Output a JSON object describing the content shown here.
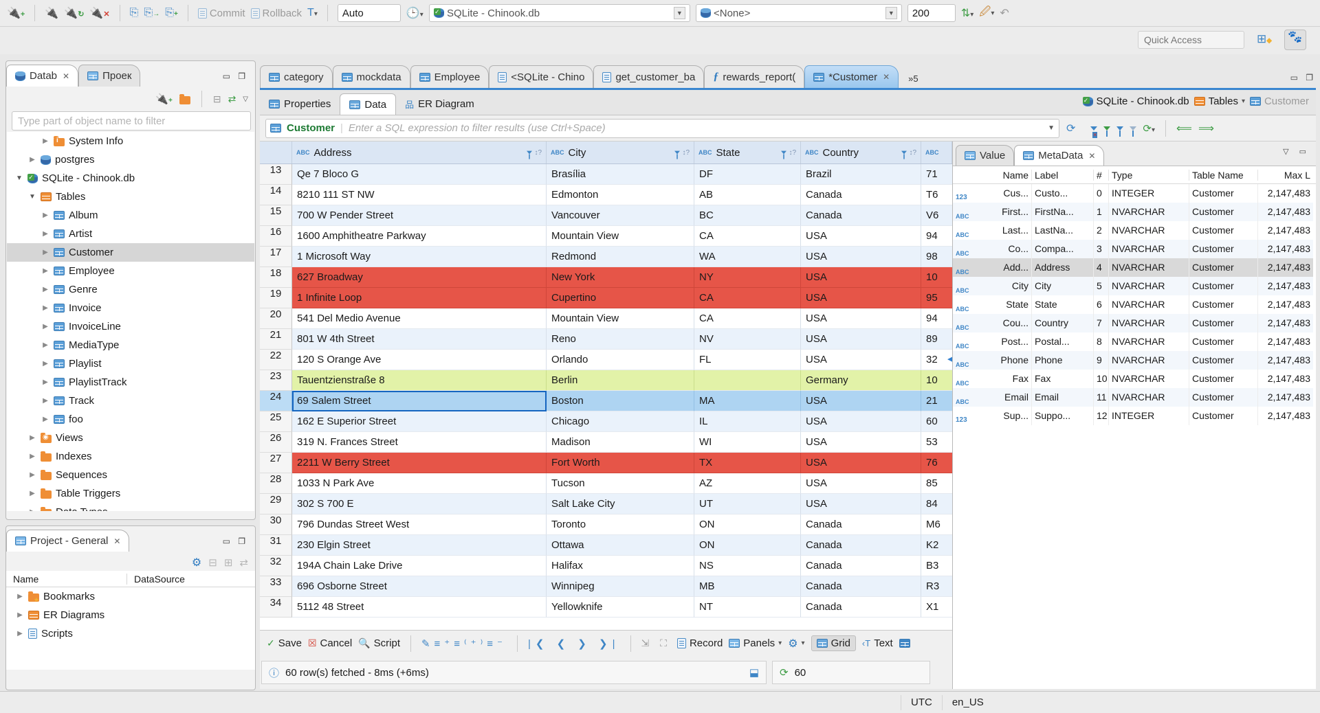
{
  "toolbar": {
    "commit_label": "Commit",
    "rollback_label": "Rollback",
    "txn_mode": "Auto",
    "connection": "SQLite - Chinook.db",
    "schema": "<None>",
    "fetch_size": "200",
    "quick_access_placeholder": "Quick Access"
  },
  "navigator": {
    "tabs": [
      {
        "label": "Datab",
        "closable": true
      },
      {
        "label": "Проек",
        "closable": false
      }
    ],
    "filter_placeholder": "Type part of object name to filter",
    "tree": [
      {
        "label": "System Info",
        "icon": "folder-info",
        "level": 2,
        "state": "collapsed",
        "selected": false
      },
      {
        "label": "postgres",
        "icon": "db",
        "level": 1,
        "state": "collapsed",
        "selected": false
      },
      {
        "label": "SQLite - Chinook.db",
        "icon": "db-check",
        "level": 0,
        "state": "expanded",
        "selected": false
      },
      {
        "label": "Tables",
        "icon": "table-folder",
        "level": 1,
        "state": "expanded",
        "selected": false
      },
      {
        "label": "Album",
        "icon": "table",
        "level": 2,
        "state": "collapsed",
        "selected": false
      },
      {
        "label": "Artist",
        "icon": "table",
        "level": 2,
        "state": "collapsed",
        "selected": false
      },
      {
        "label": "Customer",
        "icon": "table",
        "level": 2,
        "state": "collapsed",
        "selected": true
      },
      {
        "label": "Employee",
        "icon": "table",
        "level": 2,
        "state": "collapsed",
        "selected": false
      },
      {
        "label": "Genre",
        "icon": "table",
        "level": 2,
        "state": "collapsed",
        "selected": false
      },
      {
        "label": "Invoice",
        "icon": "table",
        "level": 2,
        "state": "collapsed",
        "selected": false
      },
      {
        "label": "InvoiceLine",
        "icon": "table",
        "level": 2,
        "state": "collapsed",
        "selected": false
      },
      {
        "label": "MediaType",
        "icon": "table",
        "level": 2,
        "state": "collapsed",
        "selected": false
      },
      {
        "label": "Playlist",
        "icon": "table",
        "level": 2,
        "state": "collapsed",
        "selected": false
      },
      {
        "label": "PlaylistTrack",
        "icon": "table",
        "level": 2,
        "state": "collapsed",
        "selected": false
      },
      {
        "label": "Track",
        "icon": "table",
        "level": 2,
        "state": "collapsed",
        "selected": false
      },
      {
        "label": "foo",
        "icon": "table",
        "level": 2,
        "state": "collapsed",
        "selected": false
      },
      {
        "label": "Views",
        "icon": "folder-eye",
        "level": 1,
        "state": "collapsed",
        "selected": false
      },
      {
        "label": "Indexes",
        "icon": "folder",
        "level": 1,
        "state": "collapsed",
        "selected": false
      },
      {
        "label": "Sequences",
        "icon": "folder",
        "level": 1,
        "state": "collapsed",
        "selected": false
      },
      {
        "label": "Table Triggers",
        "icon": "folder",
        "level": 1,
        "state": "collapsed",
        "selected": false
      },
      {
        "label": "Data Types",
        "icon": "folder",
        "level": 1,
        "state": "collapsed",
        "selected": false
      }
    ]
  },
  "project": {
    "title": "Project - General",
    "columns": [
      "Name",
      "DataSource"
    ],
    "items": [
      {
        "label": "Bookmarks",
        "icon": "folder-star"
      },
      {
        "label": "ER Diagrams",
        "icon": "er"
      },
      {
        "label": "Scripts",
        "icon": "scripts"
      }
    ]
  },
  "editor": {
    "tabs": [
      {
        "label": "category",
        "icon": "table",
        "active": false,
        "closable": false
      },
      {
        "label": "mockdata",
        "icon": "table",
        "active": false,
        "closable": false
      },
      {
        "label": "Employee",
        "icon": "table",
        "active": false,
        "closable": false
      },
      {
        "label": "<SQLite - Chino",
        "icon": "sql",
        "active": false,
        "closable": false
      },
      {
        "label": "get_customer_ba",
        "icon": "sql-check",
        "active": false,
        "closable": false
      },
      {
        "label": "rewards_report(",
        "icon": "fn",
        "active": false,
        "closable": false
      },
      {
        "label": "*Customer",
        "icon": "table",
        "active": true,
        "closable": true
      }
    ],
    "overflow_indicator": "»5",
    "subtabs": [
      "Properties",
      "Data",
      "ER Diagram"
    ],
    "active_subtab": "Data",
    "breadcrumb": {
      "database": "SQLite - Chinook.db",
      "container": "Tables",
      "entity": "Customer"
    }
  },
  "filter": {
    "entity": "Customer",
    "placeholder": "Enter a SQL expression to filter results (use Ctrl+Space)"
  },
  "grid": {
    "columns": [
      "Address",
      "City",
      "State",
      "Country",
      ""
    ],
    "rows": [
      {
        "n": "13",
        "address": "Qe 7 Bloco G",
        "city": "Brasília",
        "state": "DF",
        "country": "Brazil",
        "postal": "71",
        "color": "odd",
        "selected": false
      },
      {
        "n": "14",
        "address": "8210 111 ST NW",
        "city": "Edmonton",
        "state": "AB",
        "country": "Canada",
        "postal": "T6",
        "color": "even",
        "selected": false
      },
      {
        "n": "15",
        "address": "700 W Pender Street",
        "city": "Vancouver",
        "state": "BC",
        "country": "Canada",
        "postal": "V6",
        "color": "odd",
        "selected": false
      },
      {
        "n": "16",
        "address": "1600 Amphitheatre Parkway",
        "city": "Mountain View",
        "state": "CA",
        "country": "USA",
        "postal": "94",
        "color": "even",
        "selected": false
      },
      {
        "n": "17",
        "address": "1 Microsoft Way",
        "city": "Redmond",
        "state": "WA",
        "country": "USA",
        "postal": "98",
        "color": "odd",
        "selected": false
      },
      {
        "n": "18",
        "address": "627 Broadway",
        "city": "New York",
        "state": "NY",
        "country": "USA",
        "postal": "10",
        "color": "red",
        "selected": false
      },
      {
        "n": "19",
        "address": "1 Infinite Loop",
        "city": "Cupertino",
        "state": "CA",
        "country": "USA",
        "postal": "95",
        "color": "red",
        "selected": false
      },
      {
        "n": "20",
        "address": "541 Del Medio Avenue",
        "city": "Mountain View",
        "state": "CA",
        "country": "USA",
        "postal": "94",
        "color": "even",
        "selected": false
      },
      {
        "n": "21",
        "address": "801 W 4th Street",
        "city": "Reno",
        "state": "NV",
        "country": "USA",
        "postal": "89",
        "color": "odd",
        "selected": false
      },
      {
        "n": "22",
        "address": "120 S Orange Ave",
        "city": "Orlando",
        "state": "FL",
        "country": "USA",
        "postal": "32",
        "color": "even",
        "selected": false
      },
      {
        "n": "23",
        "address": "Tauentzienstraße 8",
        "city": "Berlin",
        "state": "",
        "country": "Germany",
        "postal": "10",
        "color": "green",
        "selected": false
      },
      {
        "n": "24",
        "address": "69 Salem Street",
        "city": "Boston",
        "state": "MA",
        "country": "USA",
        "postal": "21",
        "color": "sel",
        "selected": true
      },
      {
        "n": "25",
        "address": "162 E Superior Street",
        "city": "Chicago",
        "state": "IL",
        "country": "USA",
        "postal": "60",
        "color": "odd",
        "selected": false
      },
      {
        "n": "26",
        "address": "319 N. Frances Street",
        "city": "Madison",
        "state": "WI",
        "country": "USA",
        "postal": "53",
        "color": "even",
        "selected": false
      },
      {
        "n": "27",
        "address": "2211 W Berry Street",
        "city": "Fort Worth",
        "state": "TX",
        "country": "USA",
        "postal": "76",
        "color": "red",
        "selected": false
      },
      {
        "n": "28",
        "address": "1033 N Park Ave",
        "city": "Tucson",
        "state": "AZ",
        "country": "USA",
        "postal": "85",
        "color": "even",
        "selected": false
      },
      {
        "n": "29",
        "address": "302 S 700 E",
        "city": "Salt Lake City",
        "state": "UT",
        "country": "USA",
        "postal": "84",
        "color": "odd",
        "selected": false
      },
      {
        "n": "30",
        "address": "796 Dundas Street West",
        "city": "Toronto",
        "state": "ON",
        "country": "Canada",
        "postal": "M6",
        "color": "even",
        "selected": false
      },
      {
        "n": "31",
        "address": "230 Elgin Street",
        "city": "Ottawa",
        "state": "ON",
        "country": "Canada",
        "postal": "K2",
        "color": "odd",
        "selected": false
      },
      {
        "n": "32",
        "address": "194A Chain Lake Drive",
        "city": "Halifax",
        "state": "NS",
        "country": "Canada",
        "postal": "B3",
        "color": "even",
        "selected": false
      },
      {
        "n": "33",
        "address": "696 Osborne Street",
        "city": "Winnipeg",
        "state": "MB",
        "country": "Canada",
        "postal": "R3",
        "color": "odd",
        "selected": false
      },
      {
        "n": "34",
        "address": "5112 48 Street",
        "city": "Yellowknife",
        "state": "NT",
        "country": "Canada",
        "postal": "X1",
        "color": "even",
        "selected": false
      }
    ]
  },
  "metadata": {
    "tabs": [
      {
        "label": "Value",
        "active": false
      },
      {
        "label": "MetaData",
        "active": true
      }
    ],
    "columns": [
      "Name",
      "Label",
      "#",
      "Type",
      "Table Name",
      "Max L"
    ],
    "rows": [
      {
        "kind": "123",
        "name": "Cus...",
        "label": "Custo...",
        "num": "0",
        "type": "INTEGER",
        "table": "Customer",
        "max": "2,147,483",
        "selected": false
      },
      {
        "kind": "ABC",
        "name": "First...",
        "label": "FirstNa...",
        "num": "1",
        "type": "NVARCHAR",
        "table": "Customer",
        "max": "2,147,483",
        "selected": false
      },
      {
        "kind": "ABC",
        "name": "Last...",
        "label": "LastNa...",
        "num": "2",
        "type": "NVARCHAR",
        "table": "Customer",
        "max": "2,147,483",
        "selected": false
      },
      {
        "kind": "ABC",
        "name": "Co...",
        "label": "Compa...",
        "num": "3",
        "type": "NVARCHAR",
        "table": "Customer",
        "max": "2,147,483",
        "selected": false
      },
      {
        "kind": "ABC",
        "name": "Add...",
        "label": "Address",
        "num": "4",
        "type": "NVARCHAR",
        "table": "Customer",
        "max": "2,147,483",
        "selected": true
      },
      {
        "kind": "ABC",
        "name": "City",
        "label": "City",
        "num": "5",
        "type": "NVARCHAR",
        "table": "Customer",
        "max": "2,147,483",
        "selected": false
      },
      {
        "kind": "ABC",
        "name": "State",
        "label": "State",
        "num": "6",
        "type": "NVARCHAR",
        "table": "Customer",
        "max": "2,147,483",
        "selected": false
      },
      {
        "kind": "ABC",
        "name": "Cou...",
        "label": "Country",
        "num": "7",
        "type": "NVARCHAR",
        "table": "Customer",
        "max": "2,147,483",
        "selected": false
      },
      {
        "kind": "ABC",
        "name": "Post...",
        "label": "Postal...",
        "num": "8",
        "type": "NVARCHAR",
        "table": "Customer",
        "max": "2,147,483",
        "selected": false
      },
      {
        "kind": "ABC",
        "name": "Phone",
        "label": "Phone",
        "num": "9",
        "type": "NVARCHAR",
        "table": "Customer",
        "max": "2,147,483",
        "selected": false
      },
      {
        "kind": "ABC",
        "name": "Fax",
        "label": "Fax",
        "num": "10",
        "type": "NVARCHAR",
        "table": "Customer",
        "max": "2,147,483",
        "selected": false
      },
      {
        "kind": "ABC",
        "name": "Email",
        "label": "Email",
        "num": "11",
        "type": "NVARCHAR",
        "table": "Customer",
        "max": "2,147,483",
        "selected": false
      },
      {
        "kind": "123",
        "name": "Sup...",
        "label": "Suppo...",
        "num": "12",
        "type": "INTEGER",
        "table": "Customer",
        "max": "2,147,483",
        "selected": false
      }
    ]
  },
  "resultsbar": {
    "save": "Save",
    "cancel": "Cancel",
    "script": "Script",
    "record": "Record",
    "panels": "Panels",
    "grid": "Grid",
    "text": "Text"
  },
  "status": {
    "message": "60 row(s) fetched - 8ms (+6ms)",
    "refresh_count": "60"
  },
  "statusbar": {
    "timezone": "UTC",
    "locale": "en_US"
  }
}
